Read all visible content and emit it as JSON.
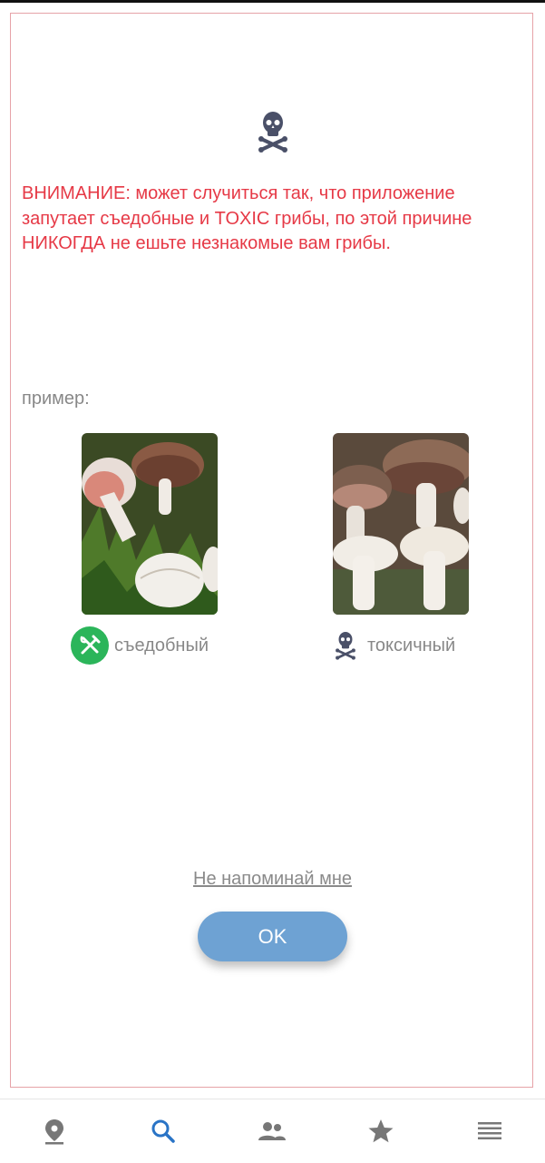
{
  "dialog": {
    "warning_text": "ВНИМАНИЕ: может случиться так, что приложение запутает съедобные и TOXIC грибы, по этой причине НИКОГДА не ешьте незнакомые вам грибы.",
    "example_label": "пример:",
    "edible_label": "съедобный",
    "toxic_label": "токсичный",
    "dont_remind": "Не напоминай мне",
    "ok_label": "OK"
  },
  "nav": {
    "items": [
      "location",
      "search",
      "community",
      "favorites",
      "menu"
    ],
    "active": "search"
  },
  "colors": {
    "warning": "#e63946",
    "accent": "#6ea2d3",
    "edible": "#2bb55a",
    "icon_gray": "#888888",
    "nav_active": "#2a74c6"
  }
}
